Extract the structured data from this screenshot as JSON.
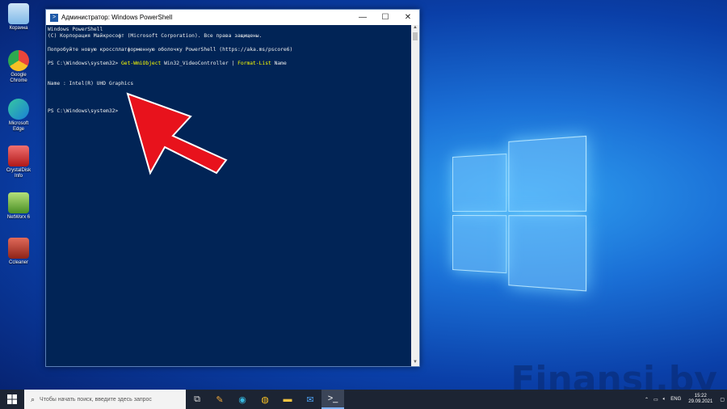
{
  "desktop": {
    "icons": [
      {
        "label": "Корзина",
        "icon": "recycle-bin-icon",
        "color": "#7fb8e8"
      },
      {
        "label": "Google Chrome",
        "icon": "chrome-icon",
        "color": "#e8453c"
      },
      {
        "label": "Microsoft Edge",
        "icon": "edge-icon",
        "color": "#1fa0e0"
      },
      {
        "label": "CrystalDisk Info",
        "icon": "crystaldisk-icon",
        "color": "#d23030"
      },
      {
        "label": "NetWorx 6",
        "icon": "networx-icon",
        "color": "#6cb33f"
      },
      {
        "label": "Ccleaner",
        "icon": "ccleaner-icon",
        "color": "#c0392b"
      }
    ]
  },
  "window": {
    "title": "Администратор: Windows PowerShell",
    "minimize": "—",
    "maximize": "☐",
    "close": "✕"
  },
  "console": {
    "line1": "Windows PowerShell",
    "line2": "(C) Корпорация Майкрософт (Microsoft Corporation). Все права защищены.",
    "line3": "Попробуйте новую кроссплатформенную оболочку PowerShell (https://aka.ms/pscore6)",
    "prompt1": "PS C:\\Windows\\system32> ",
    "cmd_a": "Get-WmiObject",
    "cmd_b": " Win32_VideoController | ",
    "cmd_c": "Format-List",
    "cmd_d": " Name",
    "output": "Name : Intel(R) UHD Graphics",
    "prompt2": "PS C:\\Windows\\system32>"
  },
  "watermark": "Finansi.by",
  "taskbar": {
    "search_placeholder": "Чтобы начать поиск, введите здесь запрос",
    "apps": [
      "task-view-icon",
      "paint-icon",
      "edge-icon",
      "chrome-icon",
      "file-explorer-icon",
      "mail-icon",
      "powershell-icon"
    ],
    "tray_lang": "ENG",
    "time": "15:22",
    "date": "29.09.2021"
  }
}
